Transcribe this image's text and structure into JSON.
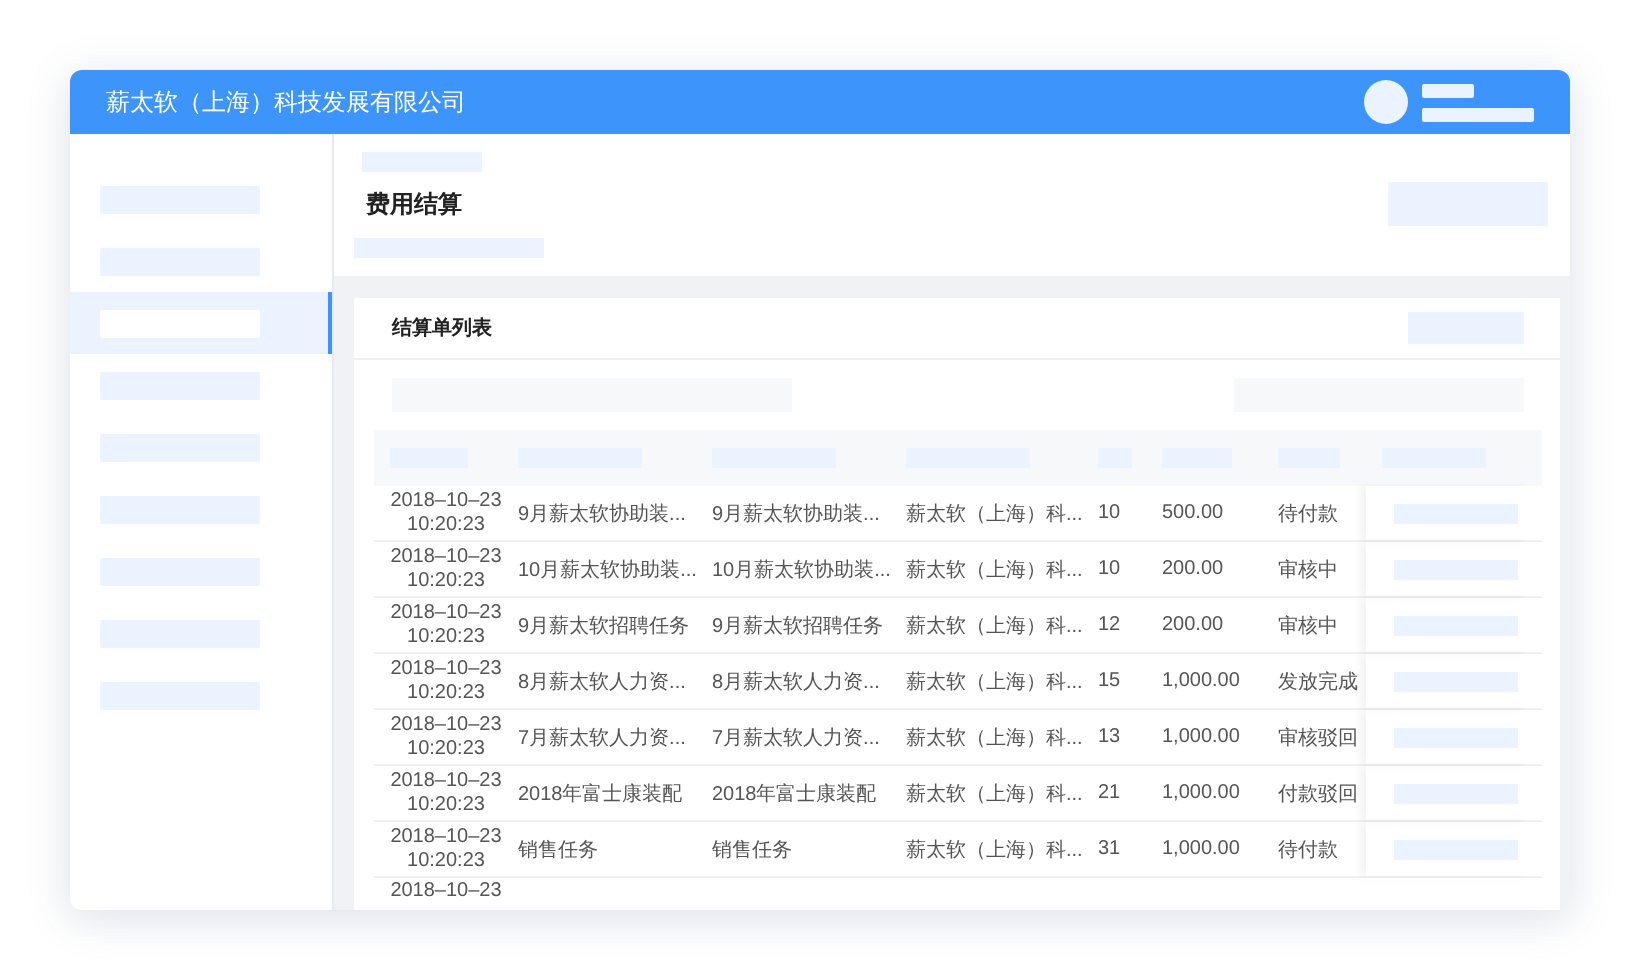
{
  "header": {
    "company": "薪太软（上海）科技发展有限公司"
  },
  "sidebar": {
    "items": [
      {
        "selected": false
      },
      {
        "selected": false
      },
      {
        "selected": true
      },
      {
        "selected": false
      },
      {
        "selected": false
      },
      {
        "selected": false
      },
      {
        "selected": false
      },
      {
        "selected": false
      },
      {
        "selected": false
      }
    ]
  },
  "page": {
    "title": "费用结算"
  },
  "card": {
    "title": "结算单列表"
  },
  "table": {
    "rows": [
      {
        "date": "2018–10–23",
        "time": "10:20:23",
        "column_2": "9月薪太软协助装...",
        "column_3": "9月薪太软协助装...",
        "column_4": "薪太软（上海）科...",
        "column_5": "10",
        "column_6": "500.00",
        "column_7": "待付款"
      },
      {
        "date": "2018–10–23",
        "time": "10:20:23",
        "column_2": "10月薪太软协助装...",
        "column_3": "10月薪太软协助装...",
        "column_4": "薪太软（上海）科...",
        "column_5": "10",
        "column_6": "200.00",
        "column_7": "审核中"
      },
      {
        "date": "2018–10–23",
        "time": "10:20:23",
        "column_2": "9月薪太软招聘任务",
        "column_3": "9月薪太软招聘任务",
        "column_4": "薪太软（上海）科...",
        "column_5": "12",
        "column_6": "200.00",
        "column_7": "审核中"
      },
      {
        "date": "2018–10–23",
        "time": "10:20:23",
        "column_2": "8月薪太软人力资...",
        "column_3": "8月薪太软人力资...",
        "column_4": "薪太软（上海）科...",
        "column_5": "15",
        "column_6": "1,000.00",
        "column_7": "发放完成"
      },
      {
        "date": "2018–10–23",
        "time": "10:20:23",
        "column_2": "7月薪太软人力资...",
        "column_3": "7月薪太软人力资...",
        "column_4": "薪太软（上海）科...",
        "column_5": "13",
        "column_6": "1,000.00",
        "column_7": "审核驳回"
      },
      {
        "date": "2018–10–23",
        "time": "10:20:23",
        "column_2": "2018年富士康装配",
        "column_3": "2018年富士康装配",
        "column_4": "薪太软（上海）科...",
        "column_5": "21",
        "column_6": "1,000.00",
        "column_7": "付款驳回"
      },
      {
        "date": "2018–10–23",
        "time": "10:20:23",
        "column_2": "销售任务",
        "column_3": "销售任务",
        "column_4": "薪太软（上海）科...",
        "column_5": "31",
        "column_6": "1,000.00",
        "column_7": "待付款"
      },
      {
        "date": "2018–10–23"
      }
    ]
  }
}
